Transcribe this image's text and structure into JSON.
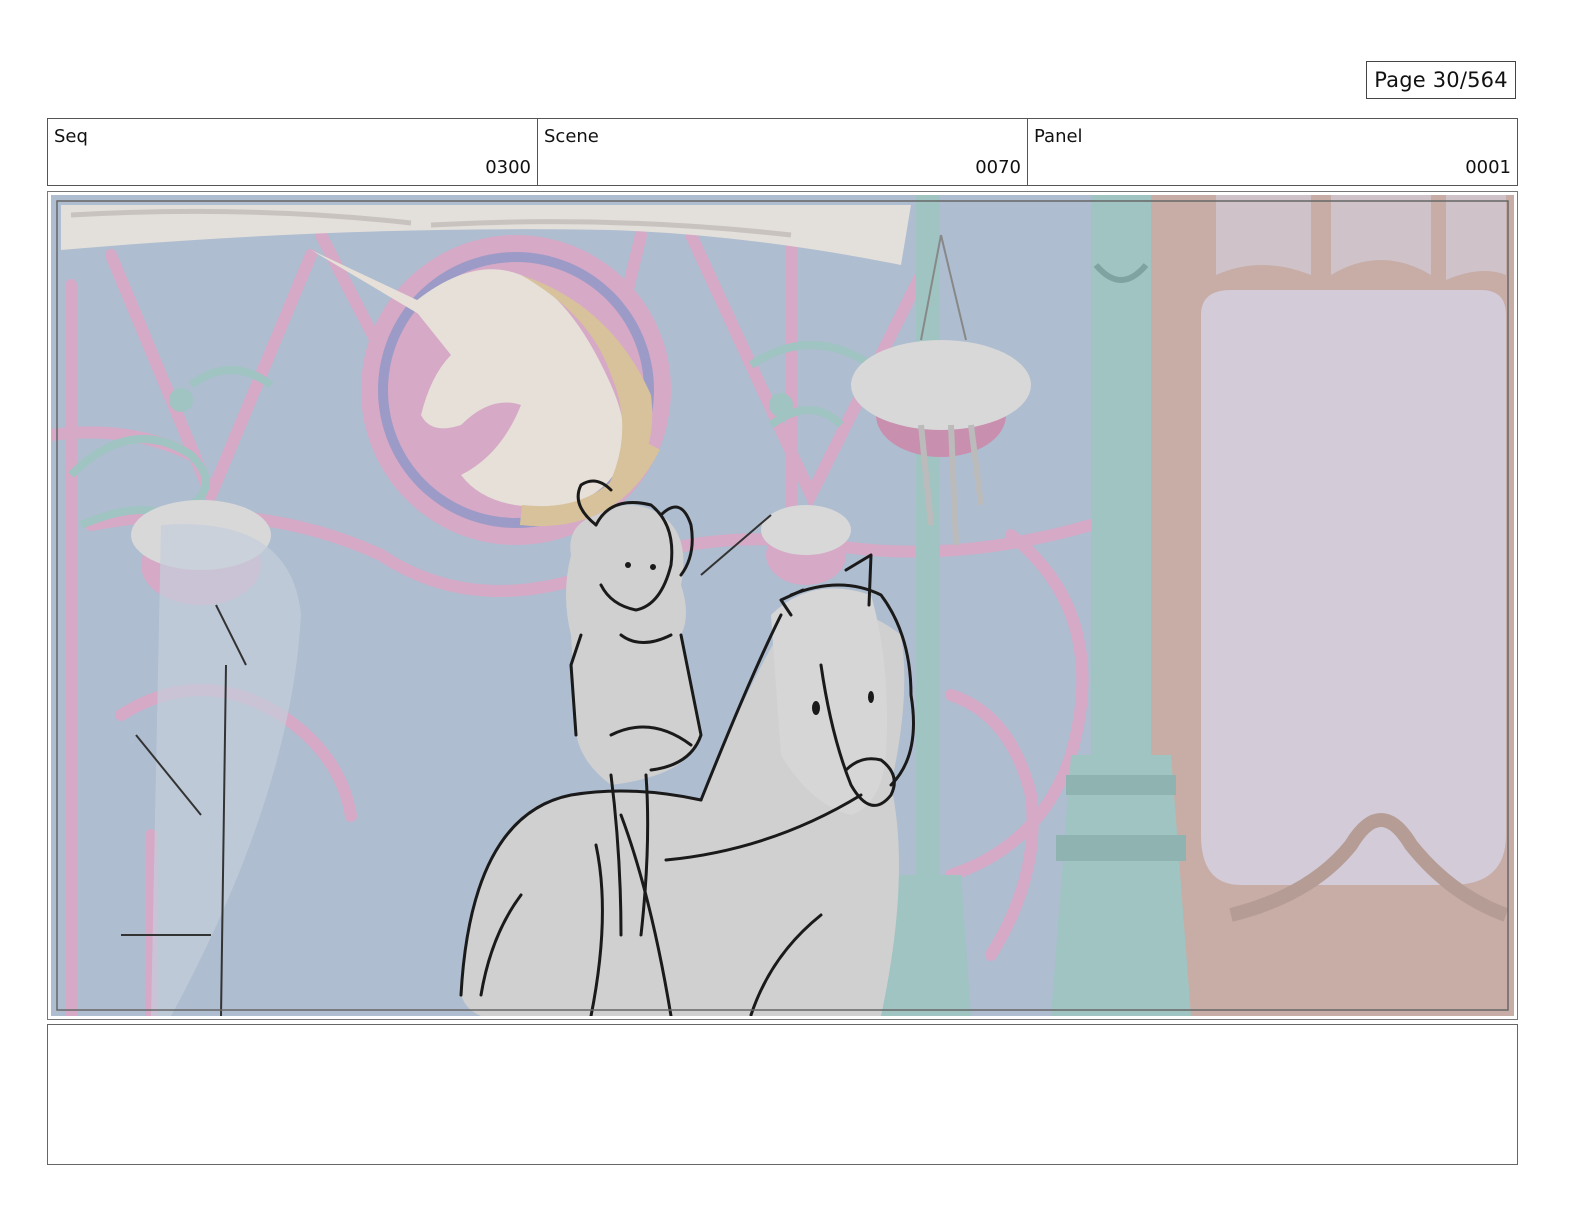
{
  "page": {
    "label": "Page",
    "current": "30",
    "total": "564",
    "display": "Page  30/564"
  },
  "header": {
    "seq": {
      "label": "Seq",
      "value": "0300"
    },
    "scene": {
      "label": "Scene",
      "value": "0070"
    },
    "panel": {
      "label": "Panel",
      "value": "0001"
    }
  },
  "artwork": {
    "description_name": "storyboard-panel-drawing",
    "colors": {
      "sky": "#aebdd0",
      "pink_frame": "#d6a9c6",
      "teal_metal": "#9fc4c2",
      "tan_wall": "#c7ada6",
      "wall_window": "#d3cbd8",
      "sign_gold": "#d7c29c",
      "sketch_fill": "#d0d0d0",
      "sketch_line": "#1a1a1a"
    }
  },
  "notes": {
    "text": ""
  }
}
